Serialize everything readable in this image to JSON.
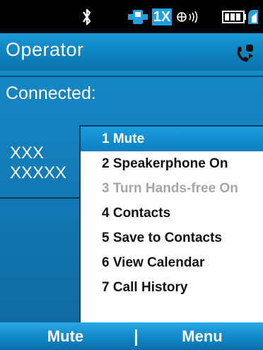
{
  "status_bar": {
    "icons": [
      "bluetooth-icon",
      "signal-strength-icon",
      "network-1x-icon",
      "roaming-icon",
      "battery-icon"
    ],
    "network_label": "1X"
  },
  "title": {
    "text": "Operator",
    "call_icon": "active-call-icon"
  },
  "call": {
    "status": "Connected:",
    "caller_name": "XXX",
    "caller_number": "XXXXX"
  },
  "menu": {
    "items": [
      {
        "label": "1 Mute",
        "state": "selected"
      },
      {
        "label": "2 Speakerphone On",
        "state": "enabled"
      },
      {
        "label": "3 Turn Hands-free On",
        "state": "disabled"
      },
      {
        "label": "4 Contacts",
        "state": "enabled"
      },
      {
        "label": "5 Save to Contacts",
        "state": "enabled"
      },
      {
        "label": "6 View Calendar",
        "state": "enabled"
      },
      {
        "label": "7 Call History",
        "state": "enabled"
      }
    ]
  },
  "softkeys": {
    "left": "Mute",
    "right": "Menu"
  },
  "colors": {
    "accent": "#1787c6",
    "selection": "#1b9ee0",
    "disabled_text": "#a6a6a6"
  }
}
